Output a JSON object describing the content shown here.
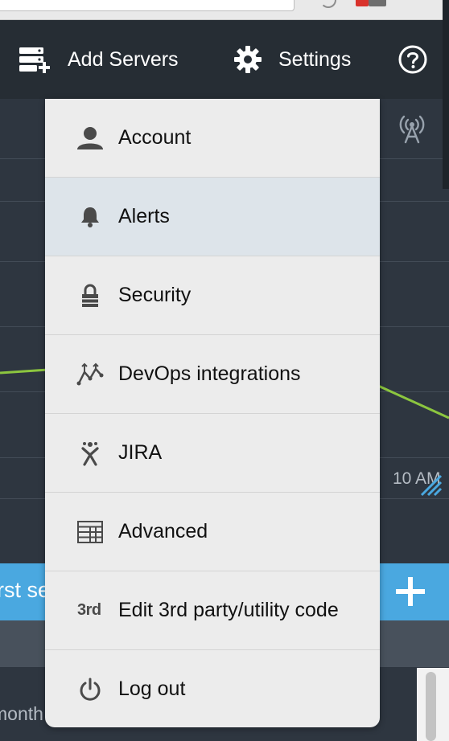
{
  "nav": {
    "add_servers_label": "Add Servers",
    "settings_label": "Settings",
    "help_icon": "question-circle-icon"
  },
  "dashboard": {
    "axis_time_label": "10 AM",
    "cta_text": "rst se",
    "month_text": "month",
    "line_color": "#8cc63f",
    "accent_color": "#4aa8e0"
  },
  "menu": {
    "items": [
      {
        "label": "Account",
        "icon": "user-icon"
      },
      {
        "label": "Alerts",
        "icon": "bell-icon",
        "active": true
      },
      {
        "label": "Security",
        "icon": "lock-icon"
      },
      {
        "label": "DevOps integrations",
        "icon": "devops-icon"
      },
      {
        "label": "JIRA",
        "icon": "jira-icon"
      },
      {
        "label": "Advanced",
        "icon": "advanced-grid-icon"
      },
      {
        "label": "Edit 3rd party/utility code",
        "icon": "third-party-icon",
        "icon_text": "3rd"
      },
      {
        "label": "Log out",
        "icon": "power-icon"
      }
    ]
  }
}
